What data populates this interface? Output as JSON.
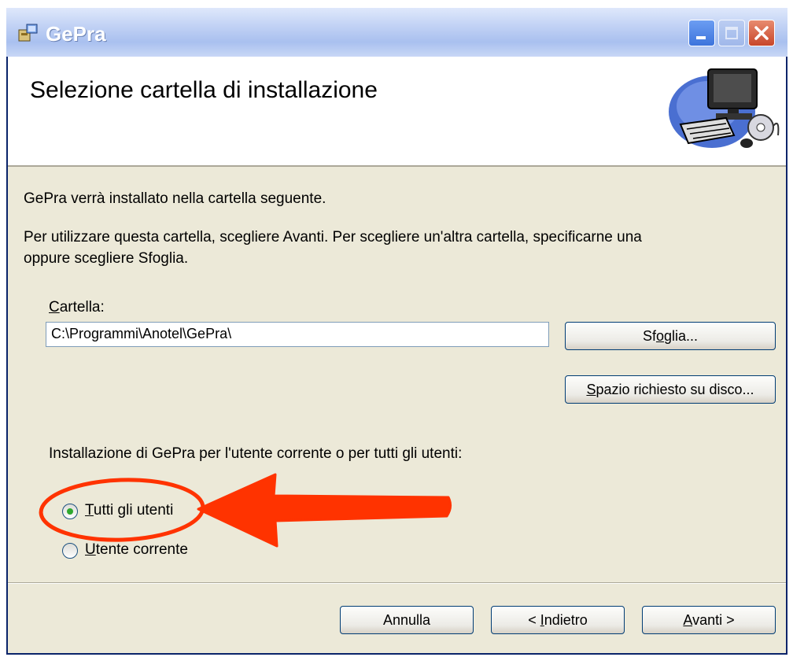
{
  "window": {
    "title": "GePra",
    "controls": {
      "minimize_icon": "minimize-icon",
      "maximize_icon": "maximize-icon",
      "close_icon": "close-icon"
    }
  },
  "header": {
    "title": "Selezione cartella di installazione",
    "art_icon": "computer-cd-icon"
  },
  "body": {
    "intro": "GePra verrà installato nella cartella seguente.",
    "instructions_line1": "Per utilizzare questa cartella, scegliere Avanti. Per scegliere un'altra cartella, specificarne una",
    "instructions_line2": "oppure scegliere Sfoglia."
  },
  "folder": {
    "label_accel": "C",
    "label_rest": "artella:",
    "value": "C:\\Programmi\\Anotel\\GePra\\",
    "browse_pre": "Sf",
    "browse_accel": "o",
    "browse_post": "glia...",
    "disk_accel": "S",
    "disk_rest": "pazio richiesto su disco..."
  },
  "install_for": {
    "question": "Installazione di GePra per l'utente corrente o per tutti gli utenti:",
    "options": [
      {
        "accel": "T",
        "rest": "utti gli utenti",
        "selected": true
      },
      {
        "accel": "U",
        "rest": "tente corrente",
        "selected": false
      }
    ]
  },
  "footer": {
    "cancel": "Annulla",
    "back_pre": "< ",
    "back_accel": "I",
    "back_rest": "ndietro",
    "next_accel": "A",
    "next_rest": "vanti >"
  },
  "colors": {
    "annotation": "#ff3300",
    "dialog_bg": "#ece9d8",
    "title_text": "#ffffff"
  }
}
